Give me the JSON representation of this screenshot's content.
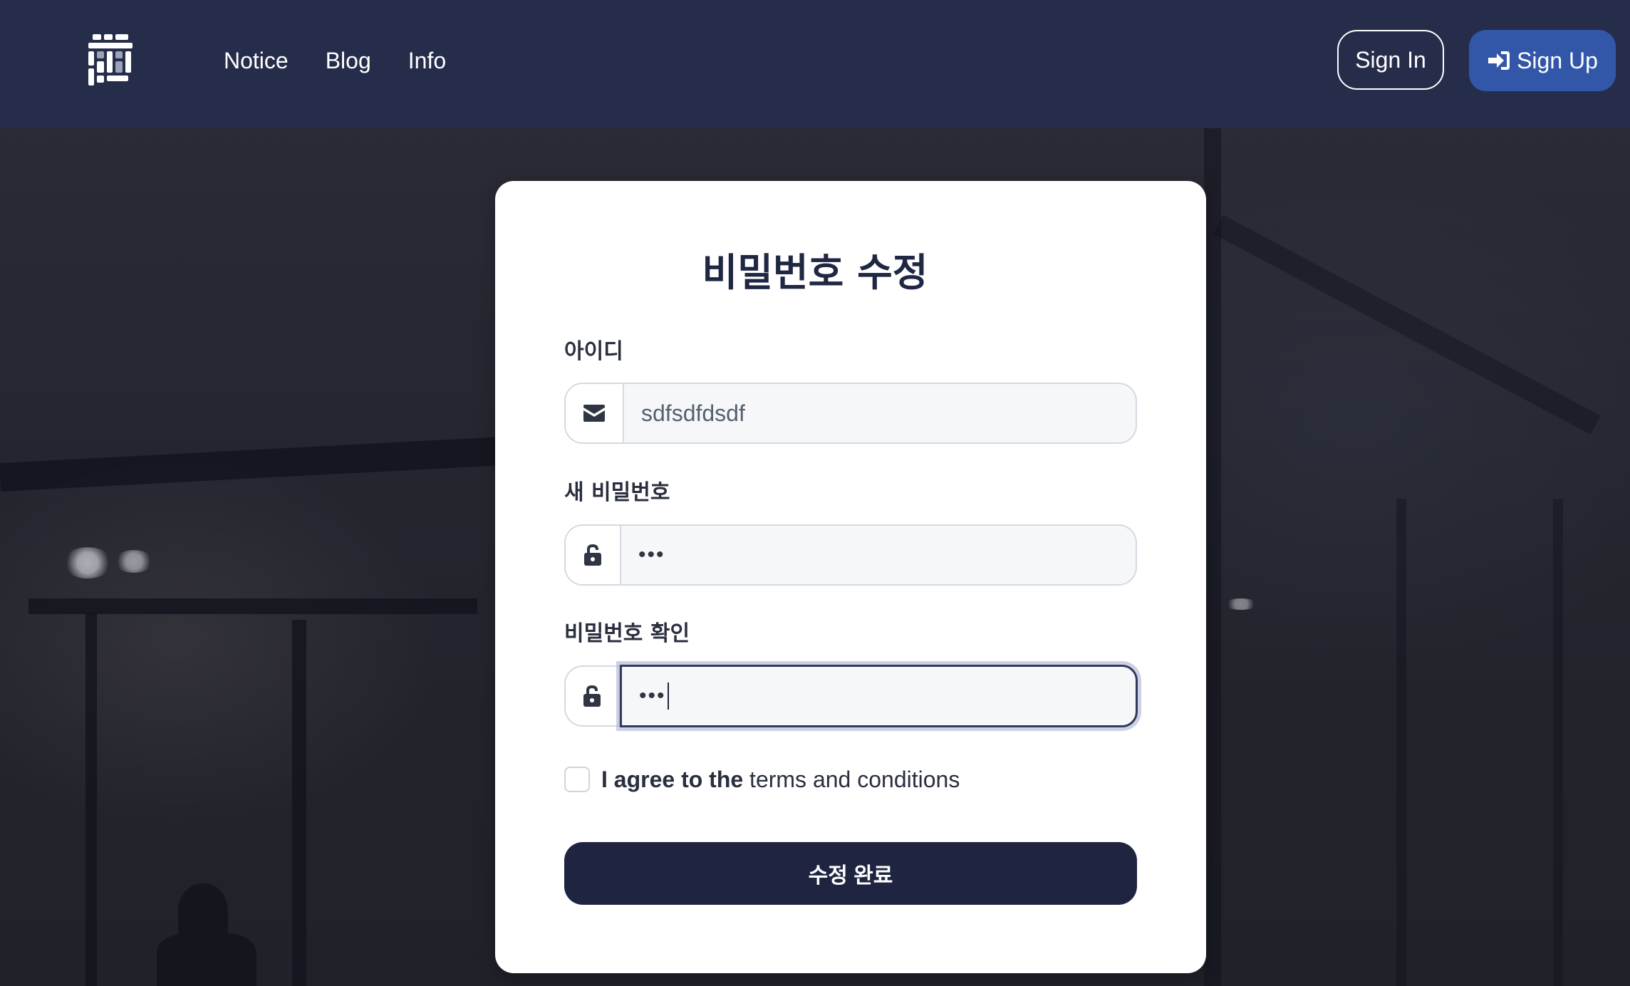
{
  "header": {
    "nav": [
      "Notice",
      "Blog",
      "Info"
    ],
    "signin_label": "Sign In",
    "signup_label": "Sign Up"
  },
  "form": {
    "title": "비밀번호 수정",
    "id_label": "아이디",
    "id_value": "sdfsdfdsdf",
    "new_password_label": "새 비밀번호",
    "new_password_mask": "•••",
    "confirm_password_label": "비밀번호 확인",
    "confirm_password_mask": "•••",
    "agree_prefix": "I agree to the",
    "agree_terms": "terms and conditions",
    "submit_label": "수정 완료"
  },
  "icons": {
    "email": "envelope-icon",
    "lock": "unlock-icon",
    "signup": "sign-in-arrow-icon"
  },
  "colors": {
    "header_bg": "#262d4a",
    "signup_bg": "#3357a8",
    "submit_bg": "#1f2540",
    "title": "#1f2742"
  }
}
